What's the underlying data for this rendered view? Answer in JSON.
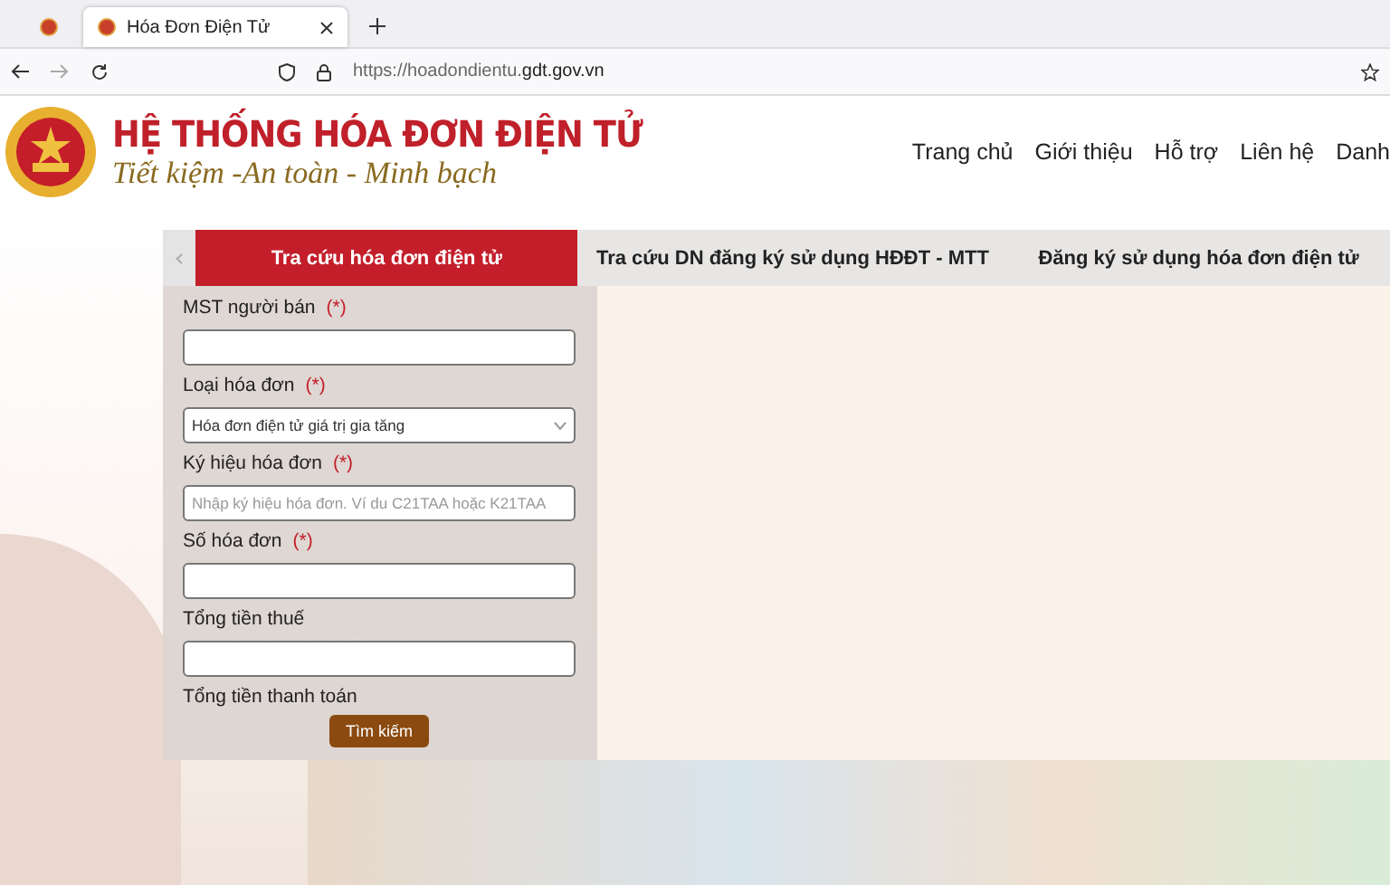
{
  "browser": {
    "tabs": [
      {
        "selected": false
      },
      {
        "title": "Hóa Đơn Điện Tử",
        "selected": true
      }
    ],
    "url": "https://hoadondientu.**gdt.gov.vn**"
  },
  "header": {
    "title": "HỆ THỐNG HÓA ĐƠN ĐIỆN TỬ",
    "slogan": "Tiết kiệm -An toàn - Minh bạch",
    "nav": [
      "Trang chủ",
      "Giới thiệu",
      "Hỗ trợ",
      "Liên hệ",
      "Danh"
    ]
  },
  "tabs": [
    {
      "label": "Tra cứu hóa đơn điện tử",
      "selected": true
    },
    {
      "label": "Tra cứu DN đăng ký sử dụng HĐĐT - MTT",
      "selected": false
    },
    {
      "label": "Đăng ký sử dụng hóa đơn điện tử",
      "selected": false
    }
  ],
  "form": {
    "fields": [
      {
        "kind": "input",
        "label": "MST người bán",
        "required_mark": "(*)"
      },
      {
        "kind": "select",
        "label": "Loại hóa đơn",
        "required_mark": "(*)",
        "value": "Hóa đơn điện tử giá trị gia tăng"
      },
      {
        "kind": "input",
        "label": "Ký hiệu hóa đơn",
        "required_mark": "(*)",
        "placeholder": "Nhập ký hiệu hóa đơn. Ví du C21TAA hoặc K21TAA"
      },
      {
        "kind": "input",
        "label": "Số hóa đơn",
        "required_mark": "(*)"
      },
      {
        "kind": "input",
        "label": "Tổng tiền thuế"
      },
      {
        "kind": "label",
        "label": "Tổng tiền thanh toán"
      }
    ],
    "button": "Tìm kiếm"
  }
}
